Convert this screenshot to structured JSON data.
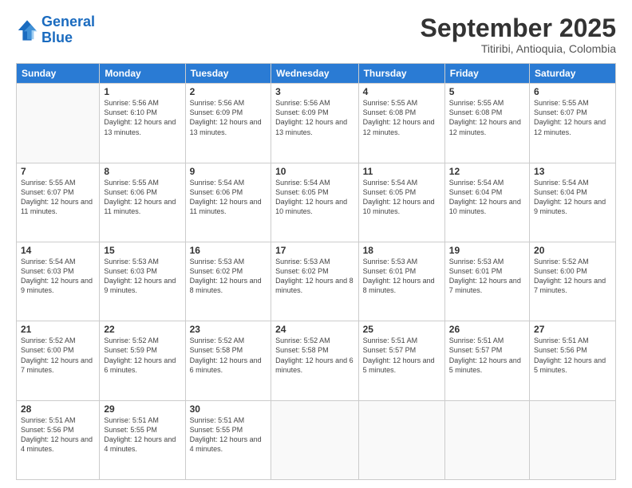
{
  "header": {
    "logo_general": "General",
    "logo_blue": "Blue",
    "month_title": "September 2025",
    "subtitle": "Titiribi, Antioquia, Colombia"
  },
  "weekdays": [
    "Sunday",
    "Monday",
    "Tuesday",
    "Wednesday",
    "Thursday",
    "Friday",
    "Saturday"
  ],
  "weeks": [
    [
      {
        "day": "",
        "sunrise": "",
        "sunset": "",
        "daylight": ""
      },
      {
        "day": "1",
        "sunrise": "Sunrise: 5:56 AM",
        "sunset": "Sunset: 6:10 PM",
        "daylight": "Daylight: 12 hours and 13 minutes."
      },
      {
        "day": "2",
        "sunrise": "Sunrise: 5:56 AM",
        "sunset": "Sunset: 6:09 PM",
        "daylight": "Daylight: 12 hours and 13 minutes."
      },
      {
        "day": "3",
        "sunrise": "Sunrise: 5:56 AM",
        "sunset": "Sunset: 6:09 PM",
        "daylight": "Daylight: 12 hours and 13 minutes."
      },
      {
        "day": "4",
        "sunrise": "Sunrise: 5:55 AM",
        "sunset": "Sunset: 6:08 PM",
        "daylight": "Daylight: 12 hours and 12 minutes."
      },
      {
        "day": "5",
        "sunrise": "Sunrise: 5:55 AM",
        "sunset": "Sunset: 6:08 PM",
        "daylight": "Daylight: 12 hours and 12 minutes."
      },
      {
        "day": "6",
        "sunrise": "Sunrise: 5:55 AM",
        "sunset": "Sunset: 6:07 PM",
        "daylight": "Daylight: 12 hours and 12 minutes."
      }
    ],
    [
      {
        "day": "7",
        "sunrise": "Sunrise: 5:55 AM",
        "sunset": "Sunset: 6:07 PM",
        "daylight": "Daylight: 12 hours and 11 minutes."
      },
      {
        "day": "8",
        "sunrise": "Sunrise: 5:55 AM",
        "sunset": "Sunset: 6:06 PM",
        "daylight": "Daylight: 12 hours and 11 minutes."
      },
      {
        "day": "9",
        "sunrise": "Sunrise: 5:54 AM",
        "sunset": "Sunset: 6:06 PM",
        "daylight": "Daylight: 12 hours and 11 minutes."
      },
      {
        "day": "10",
        "sunrise": "Sunrise: 5:54 AM",
        "sunset": "Sunset: 6:05 PM",
        "daylight": "Daylight: 12 hours and 10 minutes."
      },
      {
        "day": "11",
        "sunrise": "Sunrise: 5:54 AM",
        "sunset": "Sunset: 6:05 PM",
        "daylight": "Daylight: 12 hours and 10 minutes."
      },
      {
        "day": "12",
        "sunrise": "Sunrise: 5:54 AM",
        "sunset": "Sunset: 6:04 PM",
        "daylight": "Daylight: 12 hours and 10 minutes."
      },
      {
        "day": "13",
        "sunrise": "Sunrise: 5:54 AM",
        "sunset": "Sunset: 6:04 PM",
        "daylight": "Daylight: 12 hours and 9 minutes."
      }
    ],
    [
      {
        "day": "14",
        "sunrise": "Sunrise: 5:54 AM",
        "sunset": "Sunset: 6:03 PM",
        "daylight": "Daylight: 12 hours and 9 minutes."
      },
      {
        "day": "15",
        "sunrise": "Sunrise: 5:53 AM",
        "sunset": "Sunset: 6:03 PM",
        "daylight": "Daylight: 12 hours and 9 minutes."
      },
      {
        "day": "16",
        "sunrise": "Sunrise: 5:53 AM",
        "sunset": "Sunset: 6:02 PM",
        "daylight": "Daylight: 12 hours and 8 minutes."
      },
      {
        "day": "17",
        "sunrise": "Sunrise: 5:53 AM",
        "sunset": "Sunset: 6:02 PM",
        "daylight": "Daylight: 12 hours and 8 minutes."
      },
      {
        "day": "18",
        "sunrise": "Sunrise: 5:53 AM",
        "sunset": "Sunset: 6:01 PM",
        "daylight": "Daylight: 12 hours and 8 minutes."
      },
      {
        "day": "19",
        "sunrise": "Sunrise: 5:53 AM",
        "sunset": "Sunset: 6:01 PM",
        "daylight": "Daylight: 12 hours and 7 minutes."
      },
      {
        "day": "20",
        "sunrise": "Sunrise: 5:52 AM",
        "sunset": "Sunset: 6:00 PM",
        "daylight": "Daylight: 12 hours and 7 minutes."
      }
    ],
    [
      {
        "day": "21",
        "sunrise": "Sunrise: 5:52 AM",
        "sunset": "Sunset: 6:00 PM",
        "daylight": "Daylight: 12 hours and 7 minutes."
      },
      {
        "day": "22",
        "sunrise": "Sunrise: 5:52 AM",
        "sunset": "Sunset: 5:59 PM",
        "daylight": "Daylight: 12 hours and 6 minutes."
      },
      {
        "day": "23",
        "sunrise": "Sunrise: 5:52 AM",
        "sunset": "Sunset: 5:58 PM",
        "daylight": "Daylight: 12 hours and 6 minutes."
      },
      {
        "day": "24",
        "sunrise": "Sunrise: 5:52 AM",
        "sunset": "Sunset: 5:58 PM",
        "daylight": "Daylight: 12 hours and 6 minutes."
      },
      {
        "day": "25",
        "sunrise": "Sunrise: 5:51 AM",
        "sunset": "Sunset: 5:57 PM",
        "daylight": "Daylight: 12 hours and 5 minutes."
      },
      {
        "day": "26",
        "sunrise": "Sunrise: 5:51 AM",
        "sunset": "Sunset: 5:57 PM",
        "daylight": "Daylight: 12 hours and 5 minutes."
      },
      {
        "day": "27",
        "sunrise": "Sunrise: 5:51 AM",
        "sunset": "Sunset: 5:56 PM",
        "daylight": "Daylight: 12 hours and 5 minutes."
      }
    ],
    [
      {
        "day": "28",
        "sunrise": "Sunrise: 5:51 AM",
        "sunset": "Sunset: 5:56 PM",
        "daylight": "Daylight: 12 hours and 4 minutes."
      },
      {
        "day": "29",
        "sunrise": "Sunrise: 5:51 AM",
        "sunset": "Sunset: 5:55 PM",
        "daylight": "Daylight: 12 hours and 4 minutes."
      },
      {
        "day": "30",
        "sunrise": "Sunrise: 5:51 AM",
        "sunset": "Sunset: 5:55 PM",
        "daylight": "Daylight: 12 hours and 4 minutes."
      },
      {
        "day": "",
        "sunrise": "",
        "sunset": "",
        "daylight": ""
      },
      {
        "day": "",
        "sunrise": "",
        "sunset": "",
        "daylight": ""
      },
      {
        "day": "",
        "sunrise": "",
        "sunset": "",
        "daylight": ""
      },
      {
        "day": "",
        "sunrise": "",
        "sunset": "",
        "daylight": ""
      }
    ]
  ]
}
